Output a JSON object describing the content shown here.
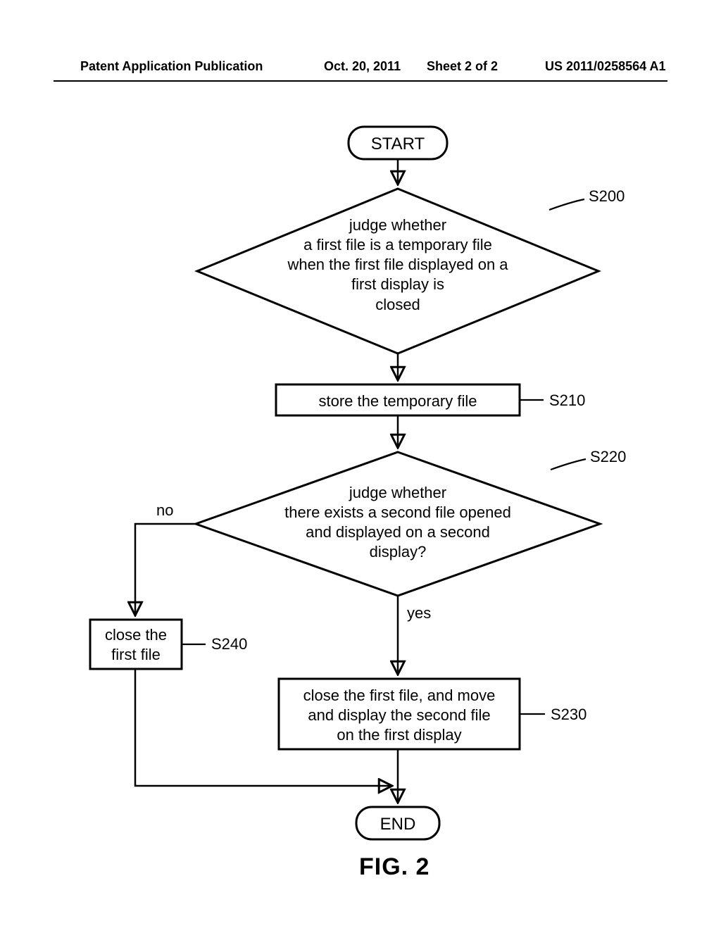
{
  "header": {
    "publication_label": "Patent Application Publication",
    "date": "Oct. 20, 2011",
    "sheet": "Sheet 2 of 2",
    "pubno": "US 2011/0258564 A1"
  },
  "flow": {
    "start": "START",
    "end": "END",
    "s200_text": "judge whether\na first file is a temporary file\nwhen the first file displayed on a\nfirst display is\nclosed",
    "s200_label": "S200",
    "s210_text": "store the temporary file",
    "s210_label": "S210",
    "s220_text": "judge whether\nthere exists a second file opened\nand displayed on a second\ndisplay?",
    "s220_label": "S220",
    "s220_yes": "yes",
    "s220_no": "no",
    "s230_text": "close the first file, and move\nand display the second file\non the first display",
    "s230_label": "S230",
    "s240_text": "close the\nfirst file",
    "s240_label": "S240",
    "caption": "FIG. 2"
  },
  "chart_data": {
    "type": "flowchart",
    "title": "FIG. 2",
    "nodes": [
      {
        "id": "START",
        "kind": "terminator",
        "text": "START"
      },
      {
        "id": "S200",
        "kind": "decision",
        "label": "S200",
        "text": "judge whether a first file is a temporary file when the first file displayed on a first display is closed"
      },
      {
        "id": "S210",
        "kind": "process",
        "label": "S210",
        "text": "store the temporary file"
      },
      {
        "id": "S220",
        "kind": "decision",
        "label": "S220",
        "text": "judge whether there exists a second file opened and displayed on a second display?"
      },
      {
        "id": "S240",
        "kind": "process",
        "label": "S240",
        "text": "close the first file"
      },
      {
        "id": "S230",
        "kind": "process",
        "label": "S230",
        "text": "close the first file, and move and display the second file on the first display"
      },
      {
        "id": "END",
        "kind": "terminator",
        "text": "END"
      }
    ],
    "edges": [
      {
        "from": "START",
        "to": "S200"
      },
      {
        "from": "S200",
        "to": "S210"
      },
      {
        "from": "S210",
        "to": "S220"
      },
      {
        "from": "S220",
        "to": "S230",
        "label": "yes"
      },
      {
        "from": "S220",
        "to": "S240",
        "label": "no"
      },
      {
        "from": "S230",
        "to": "END"
      },
      {
        "from": "S240",
        "to": "END"
      }
    ]
  }
}
